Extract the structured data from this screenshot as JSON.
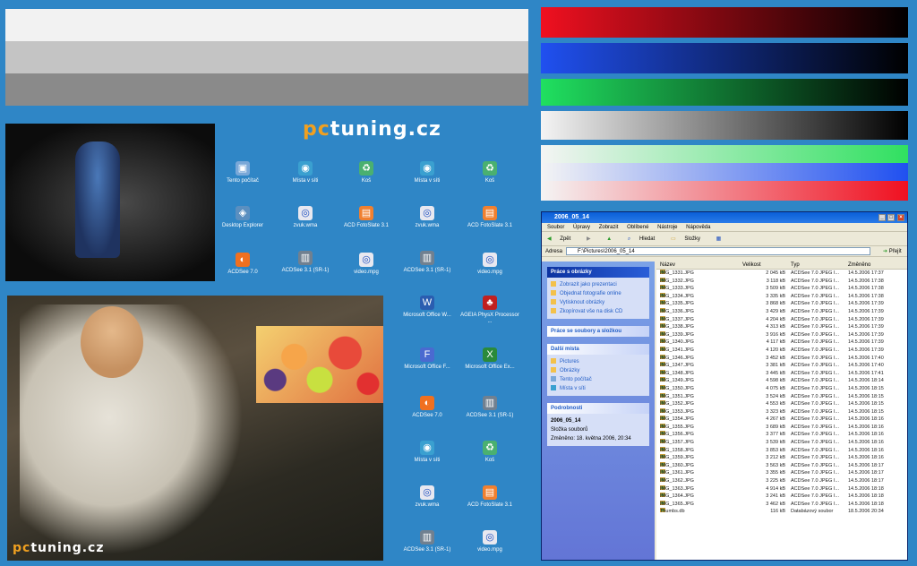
{
  "logo": {
    "pc": "pc",
    "rest": "tuning.cz"
  },
  "logo_bottom": {
    "pc": "pc",
    "rest": "tuning.cz"
  },
  "desktop_icons": [
    {
      "label": "Tento počítač"
    },
    {
      "label": "Místa v síti"
    },
    {
      "label": "Koš"
    },
    {
      "label": "Místa v síti"
    },
    {
      "label": "Koš"
    },
    {
      "label": "Desktop Explorer"
    },
    {
      "label": "zvuk.wma"
    },
    {
      "label": "ACD FotoSlate 3.1"
    },
    {
      "label": "zvuk.wma"
    },
    {
      "label": "ACD FotoSlate 3.1"
    },
    {
      "label": "ACDSee 7.0"
    },
    {
      "label": "ACDSee 3.1 (SR-1)"
    },
    {
      "label": "video.mpg"
    },
    {
      "label": "ACDSee 3.1 (SR-1)"
    },
    {
      "label": "video.mpg"
    },
    {
      "label": "Microsoft Office W..."
    },
    {
      "label": "AGEIA PhysX Processor ..."
    },
    {
      "label": "Microsoft Office F..."
    },
    {
      "label": "Microsoft Office Ex..."
    },
    {
      "label": "ACDSee 7.0"
    },
    {
      "label": "ACDSee 3.1 (SR-1)"
    },
    {
      "label": "Místa v síti"
    },
    {
      "label": "Koš"
    },
    {
      "label": "zvuk.wma"
    },
    {
      "label": "ACD FotoSlate 3.1"
    },
    {
      "label": "ACDSee 3.1 (SR-1)"
    },
    {
      "label": "video.mpg"
    }
  ],
  "explorer": {
    "title": "2006_05_14",
    "menu": [
      "Soubor",
      "Úpravy",
      "Zobrazit",
      "Oblíbené",
      "Nástroje",
      "Nápověda"
    ],
    "toolbar": {
      "back": "Zpět",
      "search": "Hledat",
      "folders": "Složky"
    },
    "address_label": "Adresa",
    "address_value": "F:\\Pictures\\2006_05_14",
    "go": "Přejít",
    "panel_pictures": {
      "title": "Práce s obrázky",
      "items": [
        "Zobrazit jako prezentaci",
        "Objednat fotografie online",
        "Vytisknout obrázky",
        "Zkopírovat vše na disk CD"
      ]
    },
    "panel_files": {
      "title": "Práce se soubory a složkou"
    },
    "panel_places": {
      "title": "Další místa",
      "items": [
        "Pictures",
        "Obrázky",
        "Tento počítač",
        "Místa v síti"
      ]
    },
    "panel_details": {
      "title": "Podrobnosti",
      "name": "2006_05_14",
      "type": "Složka souborů",
      "modified": "Změněno: 18. května 2006, 20:34"
    },
    "columns": {
      "name": "Název",
      "size": "Velikost",
      "type": "Typ",
      "modified": "Změněno"
    },
    "files": [
      {
        "name": "IMG_1331.JPG",
        "size": "2 045 kB",
        "type": "ACDSee 7.0 JPEG I...",
        "date": "14.5.2006 17:37"
      },
      {
        "name": "IMG_1332.JPG",
        "size": "3 118 kB",
        "type": "ACDSee 7.0 JPEG I...",
        "date": "14.5.2006 17:38"
      },
      {
        "name": "IMG_1333.JPG",
        "size": "3 509 kB",
        "type": "ACDSee 7.0 JPEG I...",
        "date": "14.5.2006 17:38"
      },
      {
        "name": "IMG_1334.JPG",
        "size": "3 335 kB",
        "type": "ACDSee 7.0 JPEG I...",
        "date": "14.5.2006 17:38"
      },
      {
        "name": "IMG_1335.JPG",
        "size": "3 868 kB",
        "type": "ACDSee 7.0 JPEG I...",
        "date": "14.5.2006 17:39"
      },
      {
        "name": "IMG_1336.JPG",
        "size": "3 429 kB",
        "type": "ACDSee 7.0 JPEG I...",
        "date": "14.5.2006 17:39"
      },
      {
        "name": "IMG_1337.JPG",
        "size": "4 204 kB",
        "type": "ACDSee 7.0 JPEG I...",
        "date": "14.5.2006 17:39"
      },
      {
        "name": "IMG_1338.JPG",
        "size": "4 313 kB",
        "type": "ACDSee 7.0 JPEG I...",
        "date": "14.5.2006 17:39"
      },
      {
        "name": "IMG_1339.JPG",
        "size": "3 916 kB",
        "type": "ACDSee 7.0 JPEG I...",
        "date": "14.5.2006 17:39"
      },
      {
        "name": "IMG_1340.JPG",
        "size": "4 117 kB",
        "type": "ACDSee 7.0 JPEG I...",
        "date": "14.5.2006 17:39"
      },
      {
        "name": "IMG_1341.JPG",
        "size": "4 120 kB",
        "type": "ACDSee 7.0 JPEG I...",
        "date": "14.5.2006 17:39"
      },
      {
        "name": "IMG_1346.JPG",
        "size": "3 452 kB",
        "type": "ACDSee 7.0 JPEG I...",
        "date": "14.5.2006 17:40"
      },
      {
        "name": "IMG_1347.JPG",
        "size": "3 381 kB",
        "type": "ACDSee 7.0 JPEG I...",
        "date": "14.5.2006 17:40"
      },
      {
        "name": "IMG_1348.JPG",
        "size": "3 445 kB",
        "type": "ACDSee 7.0 JPEG I...",
        "date": "14.5.2006 17:41"
      },
      {
        "name": "IMG_1349.JPG",
        "size": "4 598 kB",
        "type": "ACDSee 7.0 JPEG I...",
        "date": "14.5.2006 18:14"
      },
      {
        "name": "IMG_1350.JPG",
        "size": "4 075 kB",
        "type": "ACDSee 7.0 JPEG I...",
        "date": "14.5.2006 18:15"
      },
      {
        "name": "IMG_1351.JPG",
        "size": "3 524 kB",
        "type": "ACDSee 7.0 JPEG I...",
        "date": "14.5.2006 18:15"
      },
      {
        "name": "IMG_1352.JPG",
        "size": "4 553 kB",
        "type": "ACDSee 7.0 JPEG I...",
        "date": "14.5.2006 18:15"
      },
      {
        "name": "IMG_1353.JPG",
        "size": "3 323 kB",
        "type": "ACDSee 7.0 JPEG I...",
        "date": "14.5.2006 18:15"
      },
      {
        "name": "IMG_1354.JPG",
        "size": "4 267 kB",
        "type": "ACDSee 7.0 JPEG I...",
        "date": "14.5.2006 18:16"
      },
      {
        "name": "IMG_1355.JPG",
        "size": "3 689 kB",
        "type": "ACDSee 7.0 JPEG I...",
        "date": "14.5.2006 18:16"
      },
      {
        "name": "IMG_1356.JPG",
        "size": "3 377 kB",
        "type": "ACDSee 7.0 JPEG I...",
        "date": "14.5.2006 18:16"
      },
      {
        "name": "IMG_1357.JPG",
        "size": "3 539 kB",
        "type": "ACDSee 7.0 JPEG I...",
        "date": "14.5.2006 18:16"
      },
      {
        "name": "IMG_1358.JPG",
        "size": "3 853 kB",
        "type": "ACDSee 7.0 JPEG I...",
        "date": "14.5.2006 18:16"
      },
      {
        "name": "IMG_1359.JPG",
        "size": "3 212 kB",
        "type": "ACDSee 7.0 JPEG I...",
        "date": "14.5.2006 18:16"
      },
      {
        "name": "IMG_1360.JPG",
        "size": "3 563 kB",
        "type": "ACDSee 7.0 JPEG I...",
        "date": "14.5.2006 18:17"
      },
      {
        "name": "IMG_1361.JPG",
        "size": "3 355 kB",
        "type": "ACDSee 7.0 JPEG I...",
        "date": "14.5.2006 18:17"
      },
      {
        "name": "IMG_1362.JPG",
        "size": "3 225 kB",
        "type": "ACDSee 7.0 JPEG I...",
        "date": "14.5.2006 18:17"
      },
      {
        "name": "IMG_1363.JPG",
        "size": "4 914 kB",
        "type": "ACDSee 7.0 JPEG I...",
        "date": "14.5.2006 18:18"
      },
      {
        "name": "IMG_1364.JPG",
        "size": "3 241 kB",
        "type": "ACDSee 7.0 JPEG I...",
        "date": "14.5.2006 18:18"
      },
      {
        "name": "IMG_1365.JPG",
        "size": "3 462 kB",
        "type": "ACDSee 7.0 JPEG I...",
        "date": "14.5.2006 18:18"
      },
      {
        "name": "Thumbs.db",
        "size": "116 kB",
        "type": "Databázový soubor",
        "date": "18.5.2006 20:34"
      }
    ]
  }
}
